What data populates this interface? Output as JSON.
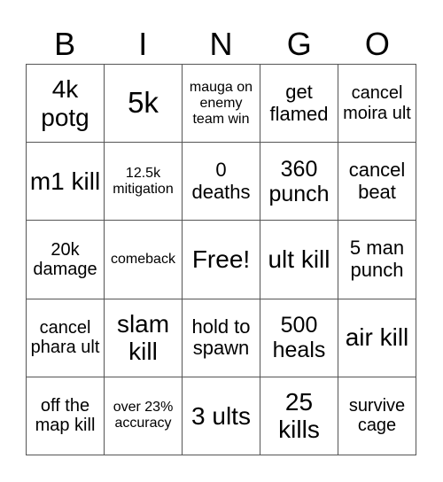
{
  "header": {
    "letters": [
      "B",
      "I",
      "N",
      "G",
      "O"
    ]
  },
  "grid": {
    "rows": [
      [
        "4k potg",
        "5k",
        "mauga on enemy team win",
        "get flamed",
        "cancel moira ult"
      ],
      [
        "m1 kill",
        "12.5k mitigation",
        "0 deaths",
        "360 punch",
        "cancel beat"
      ],
      [
        "20k damage",
        "comeback",
        "Free!",
        "ult kill",
        "5 man punch"
      ],
      [
        "cancel phara ult",
        "slam kill",
        "hold to spawn",
        "500 heals",
        "air kill"
      ],
      [
        "off the map kill",
        "over 23% accuracy",
        "3 ults",
        "25 kills",
        "survive cage"
      ]
    ],
    "free_space": "Free!"
  }
}
